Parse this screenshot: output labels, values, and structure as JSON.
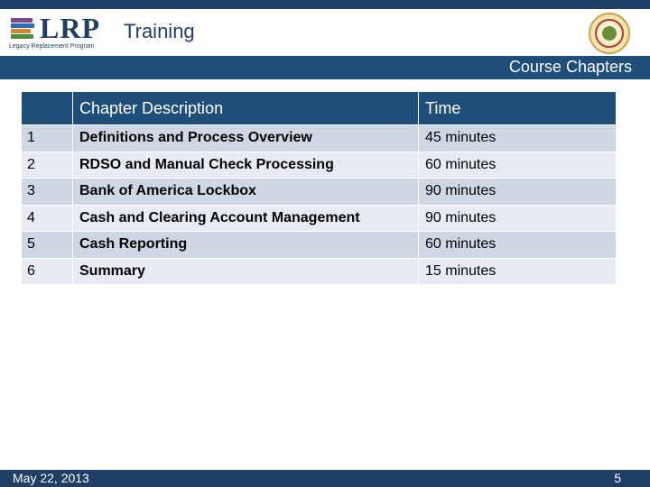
{
  "header": {
    "logo_text": "LRP",
    "logo_subtitle": "Legacy Replacement Program",
    "title": "Training",
    "subtitle": "Course Chapters"
  },
  "table": {
    "columns": [
      "",
      "Chapter Description",
      "Time"
    ],
    "rows": [
      {
        "num": "1",
        "description": "Definitions and Process Overview",
        "time": "45 minutes"
      },
      {
        "num": "2",
        "description": "RDSO and Manual Check Processing",
        "time": "60 minutes"
      },
      {
        "num": "3",
        "description": "Bank of America Lockbox",
        "time": "90 minutes"
      },
      {
        "num": "4",
        "description": "Cash and Clearing Account Management",
        "time": "90 minutes"
      },
      {
        "num": "5",
        "description": "Cash Reporting",
        "time": "60 minutes"
      },
      {
        "num": "6",
        "description": "Summary",
        "time": "15 minutes"
      }
    ]
  },
  "footer": {
    "date": "May 22, 2013",
    "page": "5"
  },
  "colors": {
    "navy": "#1f3f66",
    "band": "#1f4e79",
    "row_odd": "#cfd6e4",
    "row_even": "#e8ebf3"
  },
  "icons": [
    "books-logo-icon",
    "city-seal-icon"
  ]
}
